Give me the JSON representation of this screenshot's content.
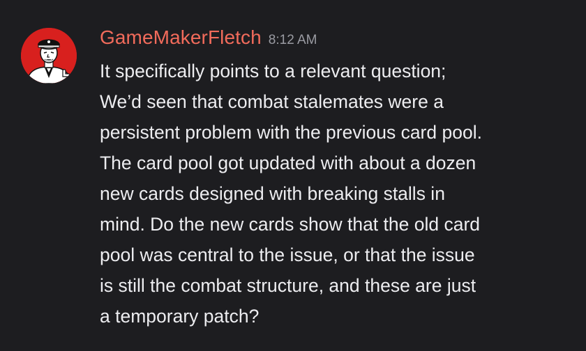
{
  "message": {
    "username": "GameMakerFletch",
    "timestamp": "8:12 AM",
    "avatar": {
      "icon": "retro-mascot-avatar-icon",
      "background_color": "#d8201e"
    },
    "lines": [
      "It specifically points to a relevant question;",
      "We’d seen that combat stalemates were a",
      "persistent problem with the previous card pool.",
      "The card pool got updated with about a dozen",
      "new cards designed with breaking stalls in",
      "mind. Do the new cards show that the old card",
      "pool was central to the issue, or that the issue",
      "is still the combat structure, and these are just",
      "a temporary patch?"
    ]
  },
  "colors": {
    "background": "#1d1d20",
    "username": "#f26b5b",
    "timestamp": "#9a9ba2",
    "text": "#ededf0"
  }
}
